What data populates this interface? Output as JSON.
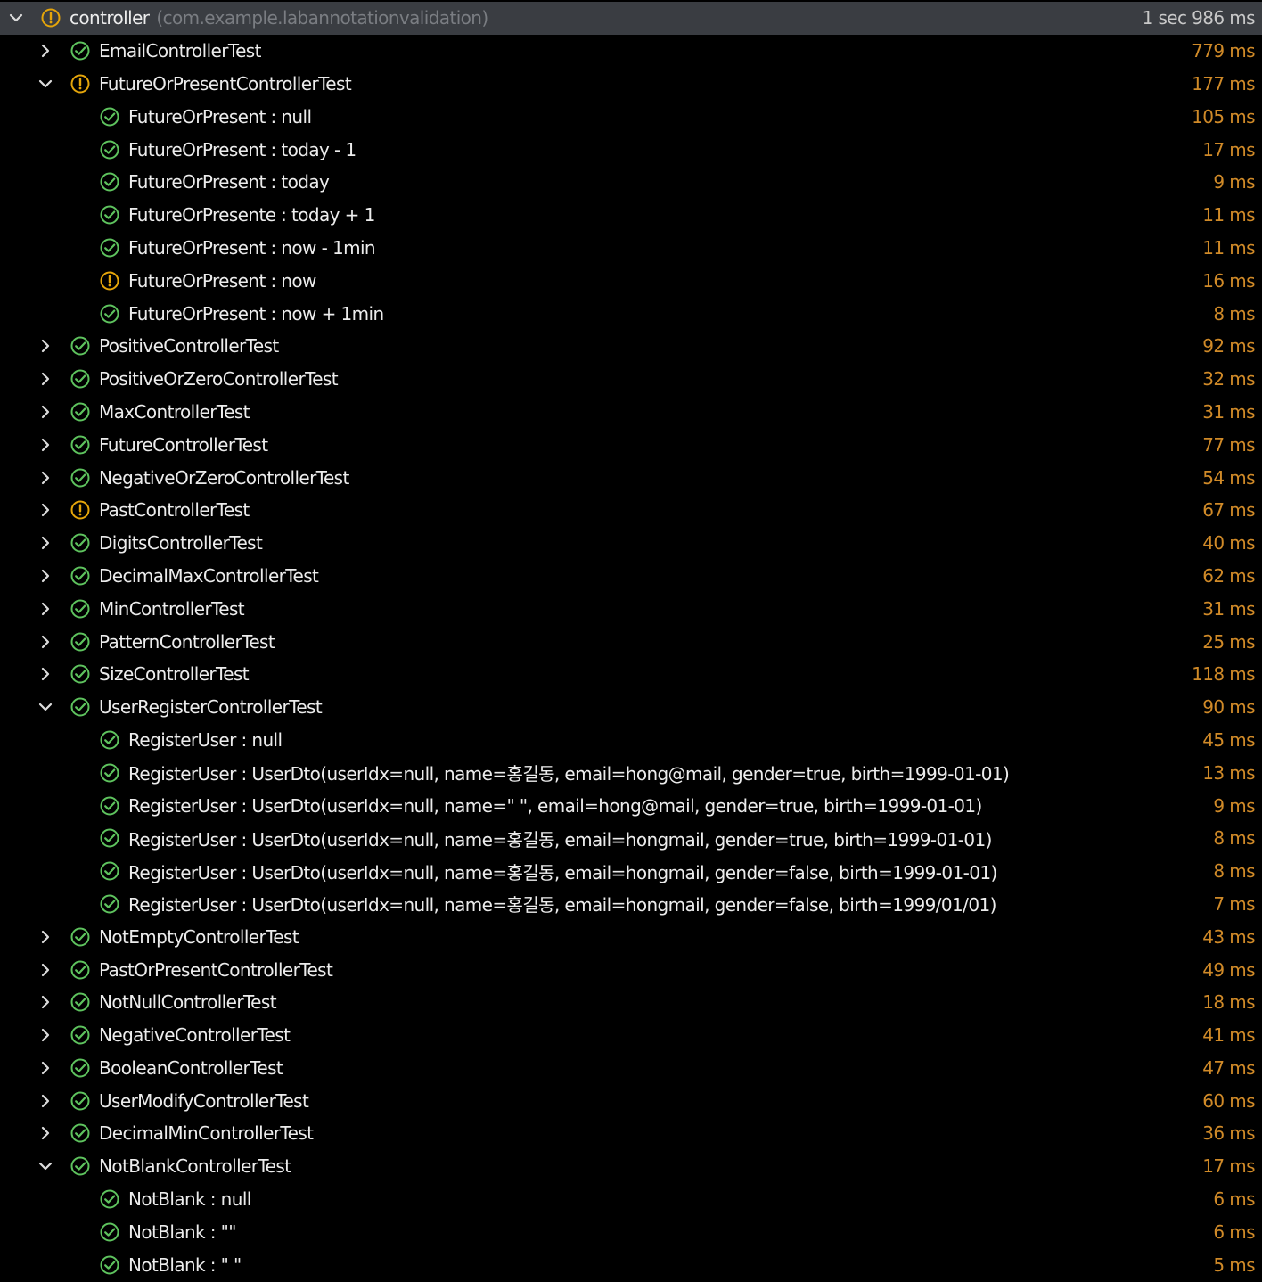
{
  "colors": {
    "passed": "#5ec35e",
    "warning": "#e5a50a",
    "duration": "#d08a28",
    "selected_row": "#3a3d42",
    "package_text": "#7a7d82"
  },
  "rows": [
    {
      "level": 0,
      "expander": "expanded",
      "status": "warning",
      "name": "controller",
      "package": "(com.example.labannotationvalidation)",
      "duration": "1 sec 986 ms",
      "selected": true
    },
    {
      "level": 1,
      "expander": "collapsed",
      "status": "passed",
      "name": "EmailControllerTest",
      "duration": "779 ms"
    },
    {
      "level": 1,
      "expander": "expanded",
      "status": "warning",
      "name": "FutureOrPresentControllerTest",
      "duration": "177 ms"
    },
    {
      "level": 2,
      "status": "passed",
      "name": "FutureOrPresent : null",
      "duration": "105 ms"
    },
    {
      "level": 2,
      "status": "passed",
      "name": "FutureOrPresent : today - 1",
      "duration": "17 ms"
    },
    {
      "level": 2,
      "status": "passed",
      "name": "FutureOrPresent : today",
      "duration": "9 ms"
    },
    {
      "level": 2,
      "status": "passed",
      "name": "FutureOrPresente : today + 1",
      "duration": "11 ms"
    },
    {
      "level": 2,
      "status": "passed",
      "name": "FutureOrPresent : now - 1min",
      "duration": "11 ms"
    },
    {
      "level": 2,
      "status": "warning",
      "name": "FutureOrPresent : now",
      "duration": "16 ms"
    },
    {
      "level": 2,
      "status": "passed",
      "name": "FutureOrPresent : now + 1min",
      "duration": "8 ms"
    },
    {
      "level": 1,
      "expander": "collapsed",
      "status": "passed",
      "name": "PositiveControllerTest",
      "duration": "92 ms"
    },
    {
      "level": 1,
      "expander": "collapsed",
      "status": "passed",
      "name": "PositiveOrZeroControllerTest",
      "duration": "32 ms"
    },
    {
      "level": 1,
      "expander": "collapsed",
      "status": "passed",
      "name": "MaxControllerTest",
      "duration": "31 ms"
    },
    {
      "level": 1,
      "expander": "collapsed",
      "status": "passed",
      "name": "FutureControllerTest",
      "duration": "77 ms"
    },
    {
      "level": 1,
      "expander": "collapsed",
      "status": "passed",
      "name": "NegativeOrZeroControllerTest",
      "duration": "54 ms"
    },
    {
      "level": 1,
      "expander": "collapsed",
      "status": "warning",
      "name": "PastControllerTest",
      "duration": "67 ms"
    },
    {
      "level": 1,
      "expander": "collapsed",
      "status": "passed",
      "name": "DigitsControllerTest",
      "duration": "40 ms"
    },
    {
      "level": 1,
      "expander": "collapsed",
      "status": "passed",
      "name": "DecimalMaxControllerTest",
      "duration": "62 ms"
    },
    {
      "level": 1,
      "expander": "collapsed",
      "status": "passed",
      "name": "MinControllerTest",
      "duration": "31 ms"
    },
    {
      "level": 1,
      "expander": "collapsed",
      "status": "passed",
      "name": "PatternControllerTest",
      "duration": "25 ms"
    },
    {
      "level": 1,
      "expander": "collapsed",
      "status": "passed",
      "name": "SizeControllerTest",
      "duration": "118 ms"
    },
    {
      "level": 1,
      "expander": "expanded",
      "status": "passed",
      "name": "UserRegisterControllerTest",
      "duration": "90 ms"
    },
    {
      "level": 2,
      "status": "passed",
      "name": "RegisterUser : null",
      "duration": "45 ms"
    },
    {
      "level": 2,
      "status": "passed",
      "name": "RegisterUser : UserDto(userIdx=null, name=홍길동, email=hong@mail, gender=true, birth=1999-01-01)",
      "duration": "13 ms"
    },
    {
      "level": 2,
      "status": "passed",
      "name": "RegisterUser : UserDto(userIdx=null, name=\" \", email=hong@mail, gender=true, birth=1999-01-01)",
      "duration": "9 ms"
    },
    {
      "level": 2,
      "status": "passed",
      "name": "RegisterUser : UserDto(userIdx=null, name=홍길동, email=hongmail, gender=true, birth=1999-01-01)",
      "duration": "8 ms"
    },
    {
      "level": 2,
      "status": "passed",
      "name": "RegisterUser : UserDto(userIdx=null, name=홍길동, email=hongmail, gender=false, birth=1999-01-01)",
      "duration": "8 ms"
    },
    {
      "level": 2,
      "status": "passed",
      "name": "RegisterUser : UserDto(userIdx=null, name=홍길동, email=hongmail, gender=false, birth=1999/01/01)",
      "duration": "7 ms"
    },
    {
      "level": 1,
      "expander": "collapsed",
      "status": "passed",
      "name": "NotEmptyControllerTest",
      "duration": "43 ms"
    },
    {
      "level": 1,
      "expander": "collapsed",
      "status": "passed",
      "name": "PastOrPresentControllerTest",
      "duration": "49 ms"
    },
    {
      "level": 1,
      "expander": "collapsed",
      "status": "passed",
      "name": "NotNullControllerTest",
      "duration": "18 ms"
    },
    {
      "level": 1,
      "expander": "collapsed",
      "status": "passed",
      "name": "NegativeControllerTest",
      "duration": "41 ms"
    },
    {
      "level": 1,
      "expander": "collapsed",
      "status": "passed",
      "name": "BooleanControllerTest",
      "duration": "47 ms"
    },
    {
      "level": 1,
      "expander": "collapsed",
      "status": "passed",
      "name": "UserModifyControllerTest",
      "duration": "60 ms"
    },
    {
      "level": 1,
      "expander": "collapsed",
      "status": "passed",
      "name": "DecimalMinControllerTest",
      "duration": "36 ms"
    },
    {
      "level": 1,
      "expander": "expanded",
      "status": "passed",
      "name": "NotBlankControllerTest",
      "duration": "17 ms"
    },
    {
      "level": 2,
      "status": "passed",
      "name": "NotBlank : null",
      "duration": "6 ms"
    },
    {
      "level": 2,
      "status": "passed",
      "name": "NotBlank : \"\"",
      "duration": "6 ms"
    },
    {
      "level": 2,
      "status": "passed",
      "name": "NotBlank : \" \"",
      "duration": "5 ms"
    }
  ]
}
